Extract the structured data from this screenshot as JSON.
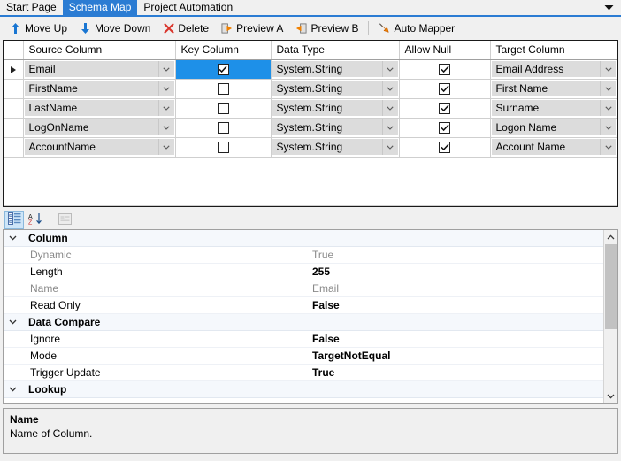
{
  "tabs": [
    {
      "label": "Start Page",
      "active": false
    },
    {
      "label": "Schema Map",
      "active": true
    },
    {
      "label": "Project Automation",
      "active": false
    }
  ],
  "tab_overflow_icon": "chevron-down-icon",
  "toolbar": {
    "buttons": [
      {
        "label": "Move Up",
        "icon": "arrow-up-icon"
      },
      {
        "label": "Move Down",
        "icon": "arrow-down-icon"
      },
      {
        "label": "Delete",
        "icon": "delete-x-icon"
      },
      {
        "label": "Preview A",
        "icon": "preview-a-icon"
      },
      {
        "label": "Preview B",
        "icon": "preview-b-icon"
      },
      {
        "label": "Auto Mapper",
        "icon": "auto-mapper-icon"
      }
    ]
  },
  "grid": {
    "columns": [
      "Source Column",
      "Key Column",
      "Data Type",
      "Allow Null",
      "Target Column"
    ],
    "rows": [
      {
        "current": true,
        "source_column": "Email",
        "key_column": true,
        "key_column_selected": true,
        "data_type": "System.String",
        "allow_null": true,
        "target_column": "Email Address"
      },
      {
        "current": false,
        "source_column": "FirstName",
        "key_column": false,
        "key_column_selected": false,
        "data_type": "System.String",
        "allow_null": true,
        "target_column": "First Name"
      },
      {
        "current": false,
        "source_column": "LastName",
        "key_column": false,
        "key_column_selected": false,
        "data_type": "System.String",
        "allow_null": true,
        "target_column": "Surname"
      },
      {
        "current": false,
        "source_column": "LogOnName",
        "key_column": false,
        "key_column_selected": false,
        "data_type": "System.String",
        "allow_null": true,
        "target_column": "Logon Name"
      },
      {
        "current": false,
        "source_column": "AccountName",
        "key_column": false,
        "key_column_selected": false,
        "data_type": "System.String",
        "allow_null": true,
        "target_column": "Account Name"
      }
    ]
  },
  "property_toolbar": {
    "categorized": {
      "icon": "categorized-icon",
      "active": true
    },
    "alphabetical": {
      "icon": "sort-az-icon",
      "active": false
    },
    "property_pages": {
      "icon": "property-pages-icon",
      "active": false,
      "disabled": true
    }
  },
  "properties": [
    {
      "type": "category",
      "name": "Column",
      "expanded": true
    },
    {
      "type": "property",
      "name": "Dynamic",
      "value": "True",
      "readonly": true
    },
    {
      "type": "property",
      "name": "Length",
      "value": "255",
      "readonly": false
    },
    {
      "type": "property",
      "name": "Name",
      "value": "Email",
      "readonly": true
    },
    {
      "type": "property",
      "name": "Read Only",
      "value": "False",
      "readonly": false
    },
    {
      "type": "category",
      "name": "Data Compare",
      "expanded": true
    },
    {
      "type": "property",
      "name": "Ignore",
      "value": "False",
      "readonly": false
    },
    {
      "type": "property",
      "name": "Mode",
      "value": "TargetNotEqual",
      "readonly": false
    },
    {
      "type": "property",
      "name": "Trigger Update",
      "value": "True",
      "readonly": false
    },
    {
      "type": "category",
      "name": "Lookup",
      "expanded": true
    }
  ],
  "help": {
    "title": "Name",
    "description": "Name of Column."
  },
  "colors": {
    "accent_blue": "#2b7cd3",
    "selection_blue": "#1e90e8",
    "grid_empty_gray": "#a8a8a8",
    "toolbar_blue_icon": "#1976d2",
    "delete_red": "#d9342b",
    "preview_orange": "#f08000"
  }
}
